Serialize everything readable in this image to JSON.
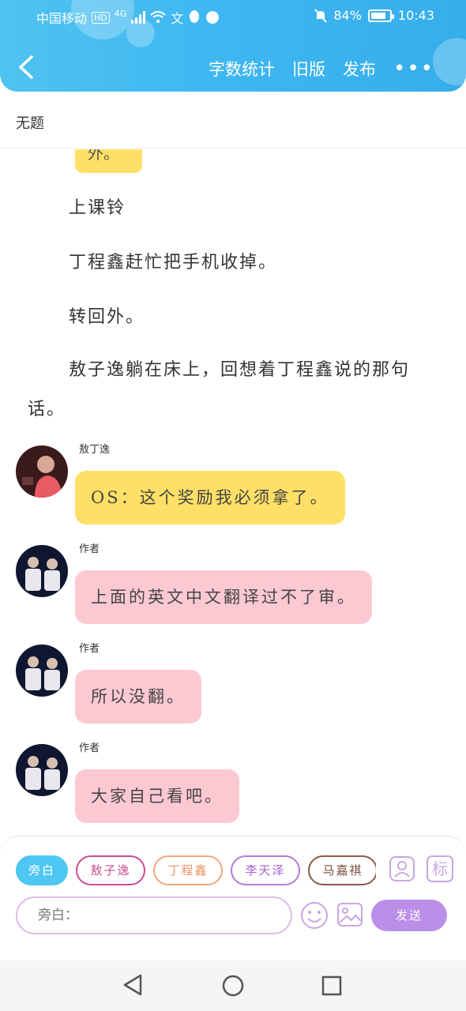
{
  "status_bar": {
    "carrier": "中国移动",
    "network": "4G",
    "battery_percent": "84%",
    "battery_level": 0.84,
    "time": "10:43"
  },
  "nav": {
    "word_count": "字数统计",
    "old_version": "旧版",
    "publish": "发布",
    "more": "•••"
  },
  "doc_title": "无题",
  "partial_bubble_text": "外。",
  "paragraphs": [
    "上课铃",
    "丁程鑫赶忙把手机收掉。",
    "转回外。",
    "敖子逸躺在床上，回想着丁程鑫说的那句话。"
  ],
  "messages": [
    {
      "name": "敖丁逸",
      "text": "OS：这个奖励我必须拿了。",
      "color": "yellow"
    },
    {
      "name": "作者",
      "text": "上面的英文中文翻译过不了审。",
      "color": "pink"
    },
    {
      "name": "作者",
      "text": "所以没翻。",
      "color": "pink"
    },
    {
      "name": "作者",
      "text": "大家自己看吧。",
      "color": "pink"
    }
  ],
  "composer": {
    "chips": [
      "旁白",
      "敖子逸",
      "丁程鑫",
      "李天泽",
      "马嘉祺"
    ],
    "character_icon": "person-icon",
    "tag_icon_label": "标",
    "placeholder": "旁白：",
    "send": "发送"
  },
  "colors": {
    "header": "#3db6f1",
    "yellow_bubble": "#ffe066",
    "pink_bubble": "#fcc9d2",
    "send": "#bb8ee8"
  }
}
